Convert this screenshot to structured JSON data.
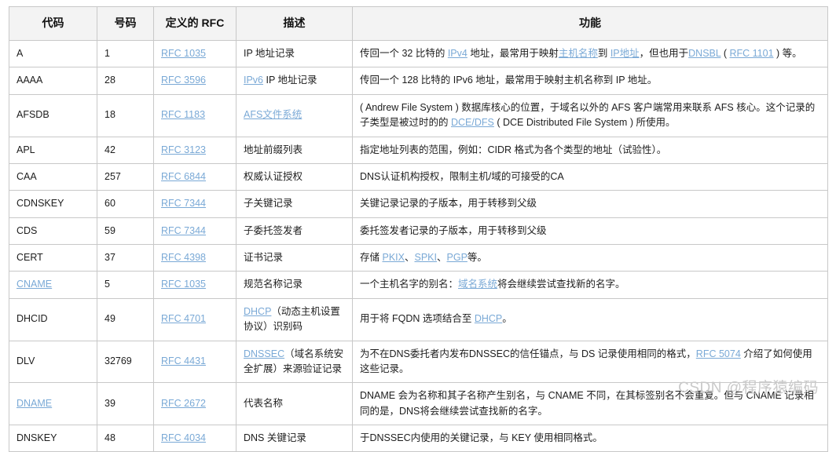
{
  "table": {
    "headers": [
      "代码",
      "号码",
      "定义的 RFC",
      "描述",
      "功能"
    ],
    "rows": [
      {
        "code": "A",
        "code_link": false,
        "number": "1",
        "rfc": "RFC 1035",
        "description": [
          {
            "t": "IP 地址记录",
            "link": false
          }
        ],
        "function": [
          {
            "t": "传回一个 32 比特的 ",
            "link": false
          },
          {
            "t": "IPv4",
            "link": true
          },
          {
            "t": " 地址，最常用于映射",
            "link": false
          },
          {
            "t": "主机名称",
            "link": true
          },
          {
            "t": "到 ",
            "link": false
          },
          {
            "t": "IP地址",
            "link": true
          },
          {
            "t": "，但也用于",
            "link": false
          },
          {
            "t": "DNSBL",
            "link": true
          },
          {
            "t": " ( ",
            "link": false
          },
          {
            "t": "RFC 1101",
            "link": true
          },
          {
            "t": " ) 等。",
            "link": false
          }
        ]
      },
      {
        "code": "AAAA",
        "code_link": false,
        "number": "28",
        "rfc": "RFC 3596",
        "description": [
          {
            "t": "IPv6",
            "link": true
          },
          {
            "t": " IP 地址记录",
            "link": false
          }
        ],
        "function": [
          {
            "t": "传回一个 128 比特的 IPv6 地址，最常用于映射主机名称到 IP 地址。",
            "link": false
          }
        ]
      },
      {
        "code": "AFSDB",
        "code_link": false,
        "number": "18",
        "rfc": "RFC 1183",
        "description": [
          {
            "t": "AFS文件系统",
            "link": true
          }
        ],
        "function": [
          {
            "t": " ( Andrew File System ) 数据库核心的位置，于域名以外的 AFS 客户端常用来联系 AFS 核心。这个记录的子类型是被过时的的 ",
            "link": false
          },
          {
            "t": "DCE/DFS",
            "link": true
          },
          {
            "t": " ( DCE Distributed File System ) 所使用。",
            "link": false
          }
        ]
      },
      {
        "code": "APL",
        "code_link": false,
        "number": "42",
        "rfc": "RFC 3123",
        "description": [
          {
            "t": "地址前缀列表",
            "link": false
          }
        ],
        "function": [
          {
            "t": "指定地址列表的范围，例如：CIDR 格式为各个类型的地址（试验性）。",
            "link": false
          }
        ]
      },
      {
        "code": "CAA",
        "code_link": false,
        "number": "257",
        "rfc": "RFC 6844",
        "description": [
          {
            "t": "权威认证授权",
            "link": false
          }
        ],
        "function": [
          {
            "t": "DNS认证机构授权，限制主机/域的可接受的CA",
            "link": false
          }
        ]
      },
      {
        "code": "CDNSKEY",
        "code_link": false,
        "number": "60",
        "rfc": "RFC 7344",
        "description": [
          {
            "t": "子关键记录",
            "link": false
          }
        ],
        "function": [
          {
            "t": "关键记录记录的子版本，用于转移到父级",
            "link": false
          }
        ]
      },
      {
        "code": "CDS",
        "code_link": false,
        "number": "59",
        "rfc": "RFC 7344",
        "description": [
          {
            "t": "子委托签发者",
            "link": false
          }
        ],
        "function": [
          {
            "t": "委托签发者记录的子版本，用于转移到父级",
            "link": false
          }
        ]
      },
      {
        "code": "CERT",
        "code_link": false,
        "number": "37",
        "rfc": "RFC 4398",
        "description": [
          {
            "t": "证书记录",
            "link": false
          }
        ],
        "function": [
          {
            "t": "存储 ",
            "link": false
          },
          {
            "t": "PKIX",
            "link": true
          },
          {
            "t": "、",
            "link": false
          },
          {
            "t": "SPKI",
            "link": true
          },
          {
            "t": "、",
            "link": false
          },
          {
            "t": "PGP",
            "link": true
          },
          {
            "t": "等。",
            "link": false
          }
        ]
      },
      {
        "code": "CNAME",
        "code_link": true,
        "number": "5",
        "rfc": "RFC 1035",
        "description": [
          {
            "t": "规范名称记录",
            "link": false
          }
        ],
        "function": [
          {
            "t": "一个主机名字的别名：",
            "link": false
          },
          {
            "t": "域名系统",
            "link": true
          },
          {
            "t": "将会继续尝试查找新的名字。",
            "link": false
          }
        ]
      },
      {
        "code": "DHCID",
        "code_link": false,
        "number": "49",
        "rfc": "RFC 4701",
        "description": [
          {
            "t": "DHCP",
            "link": true
          },
          {
            "t": "（动态主机设置协议）识别码",
            "link": false
          }
        ],
        "function": [
          {
            "t": "用于将 FQDN 选项结合至 ",
            "link": false
          },
          {
            "t": "DHCP",
            "link": true
          },
          {
            "t": "。",
            "link": false
          }
        ]
      },
      {
        "code": "DLV",
        "code_link": false,
        "number": "32769",
        "rfc": "RFC 4431",
        "description": [
          {
            "t": "DNSSEC",
            "link": true
          },
          {
            "t": "（域名系统安全扩展）来源验证记录",
            "link": false
          }
        ],
        "function": [
          {
            "t": "为不在DNS委托者内发布DNSSEC的信任锚点，与 DS 记录使用相同的格式，",
            "link": false
          },
          {
            "t": "RFC 5074",
            "link": true
          },
          {
            "t": " 介绍了如何使用这些记录。",
            "link": false
          }
        ]
      },
      {
        "code": "DNAME",
        "code_link": true,
        "number": "39",
        "rfc": "RFC 2672",
        "description": [
          {
            "t": "代表名称",
            "link": false
          }
        ],
        "function": [
          {
            "t": "DNAME 会为名称和其子名称产生别名，与 CNAME 不同，在其标签别名不会重复。但与 CNAME 记录相同的是，DNS将会继续尝试查找新的名字。",
            "link": false
          }
        ]
      },
      {
        "code": "DNSKEY",
        "code_link": false,
        "number": "48",
        "rfc": "RFC 4034",
        "description": [
          {
            "t": "DNS 关键记录",
            "link": false
          }
        ],
        "function": [
          {
            "t": "于DNSSEC内使用的关键记录，与 KEY 使用相同格式。",
            "link": false
          }
        ]
      }
    ]
  },
  "watermark": {
    "text": "CSDN @程序猿编码"
  },
  "colors": {
    "link": "#7aa9d6",
    "header_bg": "#f3f3f3",
    "border": "#c8c8c8",
    "text": "#1d1d1d",
    "watermark": "#c9c9c9"
  }
}
